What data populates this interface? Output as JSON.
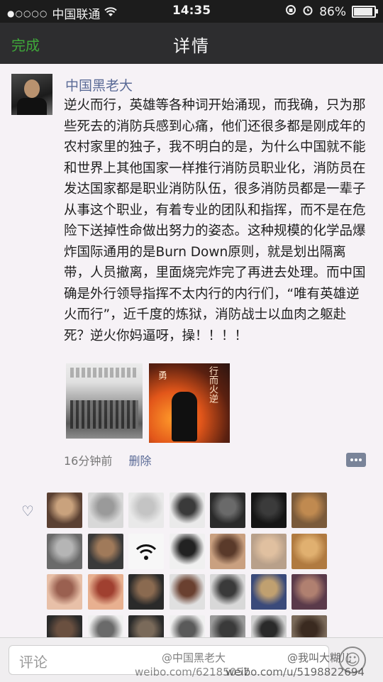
{
  "status_bar": {
    "signal_dots": "●○○○○",
    "carrier": "中国联通",
    "wifi_icon": "wifi-icon",
    "time": "14:35",
    "battery_percent": "86%",
    "battery_level": 0.86
  },
  "nav": {
    "done_label": "完成",
    "title": "详情"
  },
  "post": {
    "username": "中国黑老大",
    "content": "逆火而行，英雄等各种词开始涌现，而我确，只为那些死去的消防兵感到心痛，他们还很多都是刚成年的农村家里的独子，我不明白的是，为什么中国就不能和世界上其他国家一样推行消防员职业化，消防员在发达国家都是职业消防队伍，很多消防员都是一辈子从事这个职业，有着专业的团队和指挥，而不是在危险下送掉性命做出努力的姿态。这种规模的化学品爆炸国际通用的是Burn Down原则，就是划出隔离带，人员撤离，里面烧完炸完了再进去处理。而中国确是外行领导指挥不太内行的内行们，“唯有英雄逆火而行”，近千度的炼狱，消防战士以血肉之躯赴死？逆火你妈逼呀，操！！！！",
    "photo2_text": [
      "行而火逆",
      "勇"
    ],
    "time_ago": "16分钟前",
    "delete_label": "删除"
  },
  "likes": {
    "heart_icon": "heart-icon",
    "count": 28
  },
  "bottom": {
    "comment_placeholder": "评论",
    "emoji_icon": "emoji-icon"
  },
  "watermarks": {
    "mid_top": "@中国黑老大",
    "mid_bottom": "weibo.com/62185057",
    "right_top": "@我叫大糊儿",
    "right_bottom": "weibo.com/u/5198822694"
  }
}
